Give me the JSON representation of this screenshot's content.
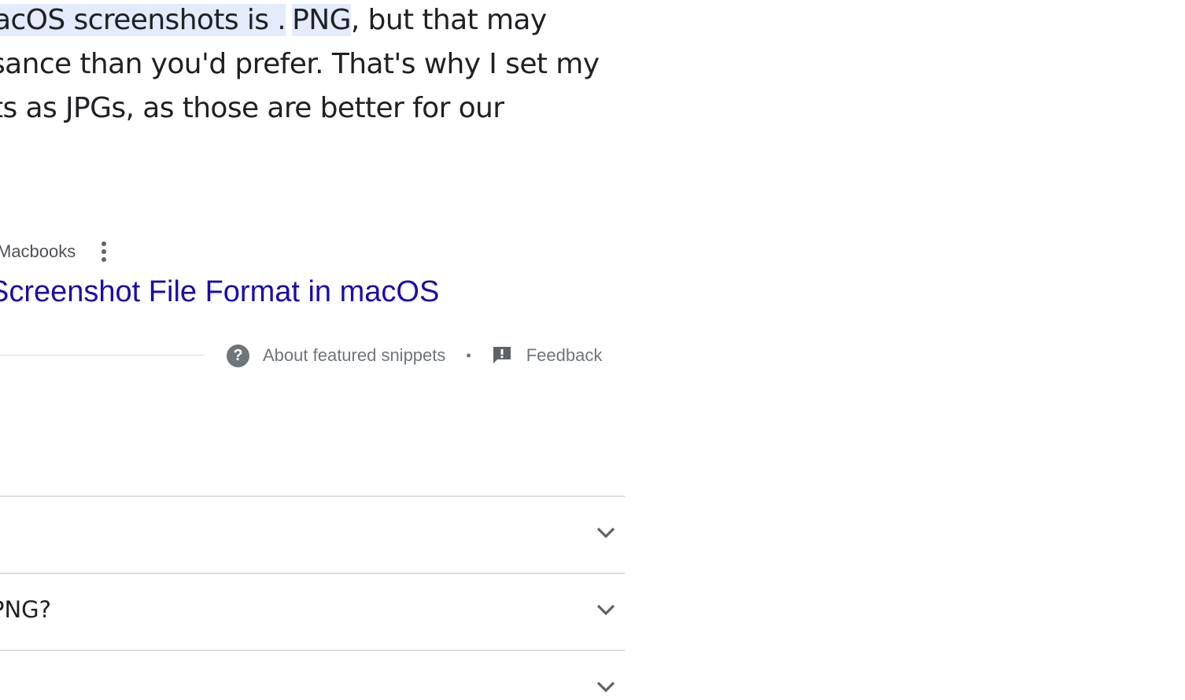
{
  "snippet": {
    "line1_pre": "acOS screenshots is .",
    "line1_highlight2": "PNG",
    "line1_post": ", but that may",
    "line2": "sance than you'd prefer. That's why I set my",
    "line3": "ts as JPGs, as those are better for our"
  },
  "source": {
    "name": "Macbooks",
    "more_icon": "more-vert-icon"
  },
  "result": {
    "title": "Screenshot File Format in macOS"
  },
  "snippet_footer": {
    "about_label": "About featured snippets",
    "separator": "•",
    "feedback_label": "Feedback",
    "help_icon": "help-icon",
    "feedback_icon": "feedback-icon"
  },
  "people_also_ask": {
    "questions": [
      "",
      "PNG?",
      ""
    ],
    "chevron_icon": "chevron-down-icon"
  },
  "colors": {
    "link": "#1a0dab",
    "text": "#202124",
    "muted": "#70757a",
    "highlight": "#e3ebfd",
    "divider": "#dadce0"
  }
}
